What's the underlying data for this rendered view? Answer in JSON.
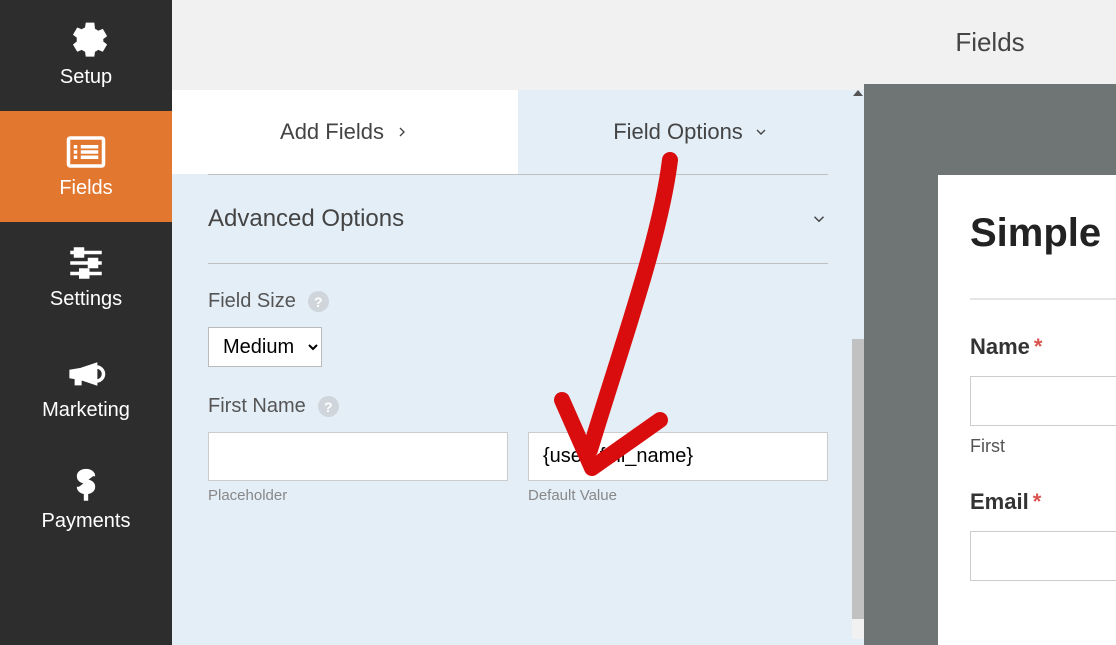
{
  "sidebar": {
    "items": [
      {
        "label": "Setup"
      },
      {
        "label": "Fields"
      },
      {
        "label": "Settings"
      },
      {
        "label": "Marketing"
      },
      {
        "label": "Payments"
      }
    ]
  },
  "tabs": {
    "add": "Add Fields",
    "options": "Field Options"
  },
  "advanced": {
    "title": "Advanced Options"
  },
  "field_size": {
    "label": "Field Size",
    "value": "Medium"
  },
  "first_name": {
    "label": "First Name",
    "placeholder_value": "",
    "placeholder_label": "Placeholder",
    "default_value": "{user_full_name}",
    "default_label": "Default Value"
  },
  "right": {
    "header": "Fields"
  },
  "preview": {
    "form_title": "Simple",
    "name": {
      "label": "Name",
      "sublabel": "First"
    },
    "email": {
      "label": "Email"
    }
  }
}
